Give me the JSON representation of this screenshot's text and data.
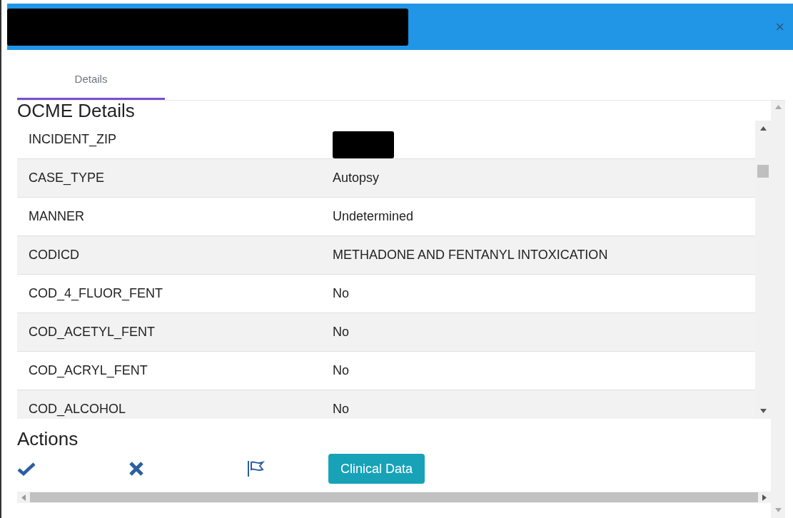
{
  "window": {
    "title_redacted": true,
    "close": "×"
  },
  "tabs": [
    {
      "label": "Details",
      "selected": true
    }
  ],
  "section": {
    "title": "OCME Details",
    "rows": [
      {
        "field": "INCIDENT_ZIP",
        "redacted": true
      },
      {
        "field": "CASE_TYPE",
        "value": "Autopsy"
      },
      {
        "field": "MANNER",
        "value": "Undetermined"
      },
      {
        "field": "CODICD",
        "value": "METHADONE AND FENTANYL INTOXICATION"
      },
      {
        "field": "COD_4_FLUOR_FENT",
        "value": "No"
      },
      {
        "field": "COD_ACETYL_FENT",
        "value": "No"
      },
      {
        "field": "COD_ACRYL_FENT",
        "value": "No"
      },
      {
        "field": "COD_ALCOHOL",
        "value": "No"
      }
    ]
  },
  "actions": {
    "title": "Actions",
    "items": [
      {
        "kind": "check"
      },
      {
        "kind": "cross"
      },
      {
        "kind": "flag"
      },
      {
        "kind": "button",
        "label": "Clinical Data"
      }
    ]
  }
}
